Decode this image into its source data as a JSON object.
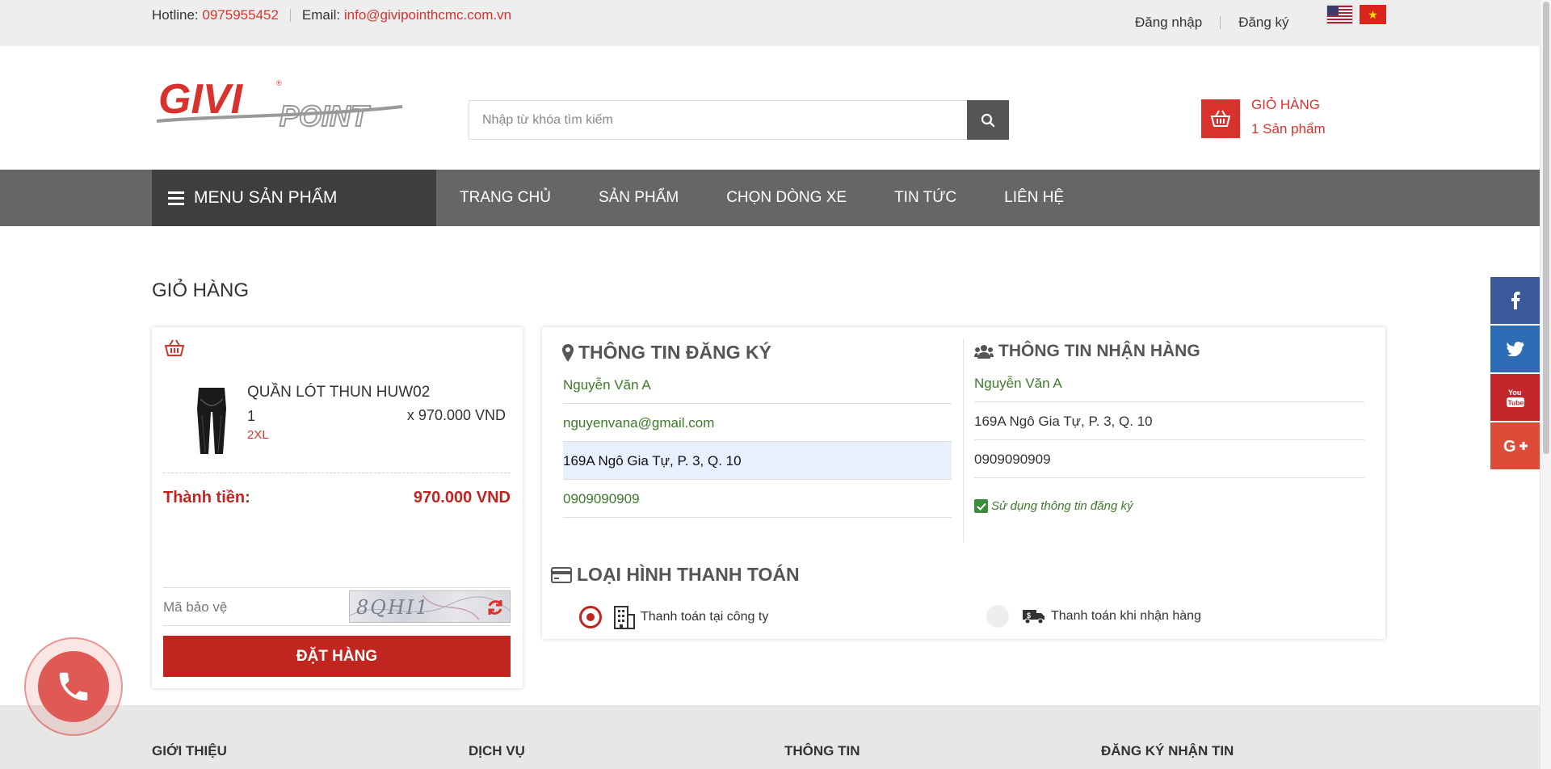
{
  "topbar": {
    "hotline_label": "Hotline:",
    "hotline_value": "0975955452",
    "email_label": "Email:",
    "email_value": "info@givipointhcmc.com.vn",
    "login": "Đăng nhập",
    "register": "Đăng ký"
  },
  "header": {
    "logo_text": "GIVI POINT",
    "search_placeholder": "Nhập từ khóa tìm kiếm",
    "cart_title": "GIỎ HÀNG",
    "cart_count": "1 Sản phẩm"
  },
  "nav": {
    "menu_label": "MENU SẢN PHẨM",
    "items": [
      {
        "label": "TRANG CHỦ"
      },
      {
        "label": "SẢN PHẨM"
      },
      {
        "label": "CHỌN DÒNG XE"
      },
      {
        "label": "TIN TỨC"
      },
      {
        "label": "LIÊN HỆ"
      }
    ]
  },
  "page_title": "GIỎ HÀNG",
  "cart": {
    "item_name": "QUẦN LÓT THUN HUW02",
    "qty": "1",
    "price": "x 970.000 VND",
    "size": "2XL",
    "total_label": "Thành tiền:",
    "total_value": "970.000 VND",
    "captcha_label": "Mã bảo vệ",
    "captcha_code": "8QHI1",
    "order_button": "ĐẶT HÀNG"
  },
  "registration": {
    "title": "THÔNG TIN ĐĂNG KÝ",
    "name": "Nguyễn Văn A",
    "email": "nguyenvana@gmail.com",
    "address": "169A Ngô Gia Tự, P. 3, Q. 10",
    "phone": "0909090909"
  },
  "receiving": {
    "title": "THÔNG TIN NHẬN HÀNG",
    "name": "Nguyễn Văn A",
    "address": "169A Ngô Gia Tự, P. 3, Q. 10",
    "phone": "0909090909",
    "use_registration": "Sử dụng thông tin đăng ký"
  },
  "payment": {
    "title": "LOẠI HÌNH THANH TOÁN",
    "options": [
      {
        "label": "Thanh toán tại công ty",
        "selected": true
      },
      {
        "label": "Thanh toán khi nhận hàng",
        "selected": false
      }
    ]
  },
  "footer": {
    "columns": [
      "GIỚI THIỆU",
      "DỊCH VỤ",
      "THÔNG TIN",
      "ĐĂNG KÝ NHẬN TIN"
    ]
  },
  "colors": {
    "accent": "#d9322c",
    "nav_bg": "#666666",
    "menu_bg": "#3e3e3e",
    "field_green": "#3d7a2a"
  },
  "icons": {
    "search": "search-icon",
    "cart": "basket-icon",
    "location": "map-marker-icon",
    "users": "users-icon",
    "payment": "credit-card-icon",
    "company": "building-icon",
    "delivery": "delivery-truck-icon",
    "phone": "phone-icon"
  }
}
